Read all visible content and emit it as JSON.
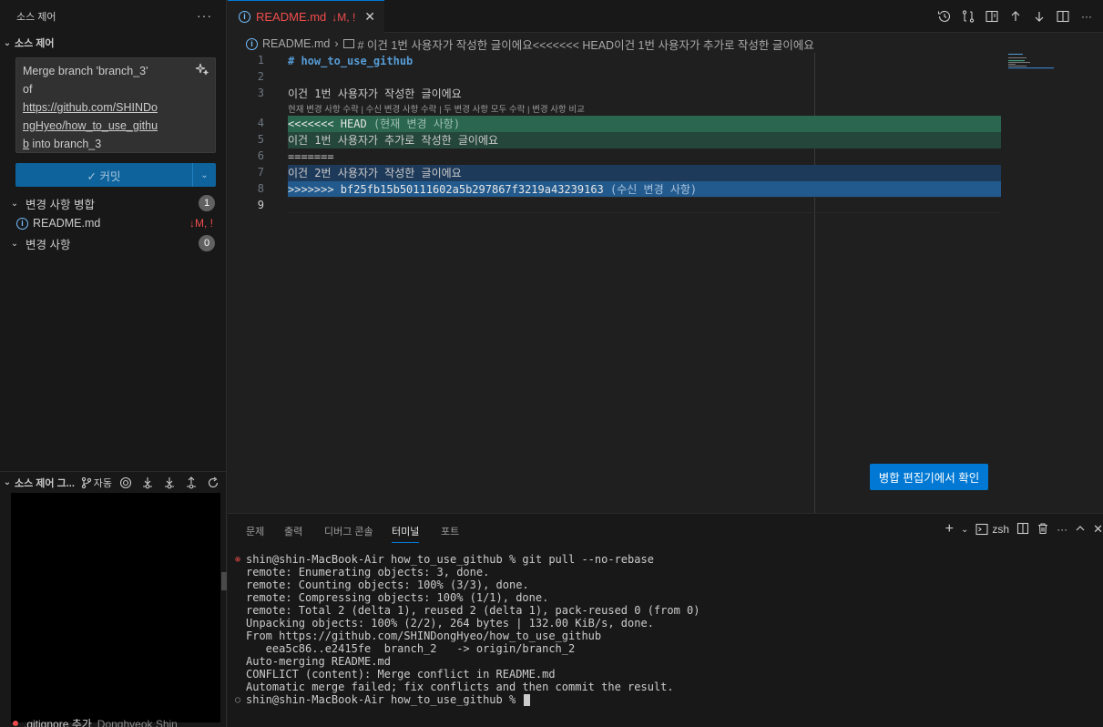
{
  "sidebar": {
    "header_title": "소스 제어",
    "more_label": "···",
    "section_title": "소스 제어",
    "commit_message_lines": [
      "Merge branch 'branch_3'",
      "of",
      "https://github.com/SHINDo",
      "ngHyeo/how_to_use_githu",
      "b into branch_3"
    ],
    "commit_button_label": "커밋",
    "merge_changes": {
      "label": "변경 사항 병합",
      "count": "1"
    },
    "file": {
      "name": "README.md",
      "status": "↓M, !"
    },
    "changes": {
      "label": "변경 사항",
      "count": "0"
    },
    "graph": {
      "title": "소스 제어 그...",
      "auto_label": "자동"
    },
    "gitignore_row": {
      "text": ".gitignore 추가",
      "author": "Donghyeok Shin"
    }
  },
  "editor": {
    "tab": {
      "name": "README.md",
      "status": "↓M, !"
    },
    "breadcrumb": {
      "file": "README.md",
      "symbol": "# 이건 1번 사용자가 작성한 글이에요<<<<<<< HEAD이건 1번 사용자가 추가로 작성한 글이에요"
    },
    "line_numbers": [
      "1",
      "2",
      "3",
      "4",
      "5",
      "6",
      "7",
      "8",
      "9"
    ],
    "lines": {
      "l1": "# how_to_use_github",
      "l3": "이건 1번 사용자가 작성한 글이에요",
      "codelens": "현재 변경 사항 수락 | 수신 변경 사항 수락 | 두 변경 사항 모두 수락 | 변경 사항 비교",
      "l4_marker": "<<<<<<< HEAD",
      "l4_hint": "(현재 변경 사항)",
      "l5": "이건 1번 사용자가 추가로 작성한 글이에요",
      "l6": "=======",
      "l7": "이건 2번 사용자가 작성한 글이에요",
      "l8_marker": ">>>>>>> bf25fb15b50111602a5b297867f3219a43239163",
      "l8_hint": "(수신 변경 사항)"
    },
    "merge_editor_button": "병합 편집기에서 확인"
  },
  "panel": {
    "tabs": [
      "문제",
      "출력",
      "디버그 콘솔",
      "터미널",
      "포트"
    ],
    "active_tab": "터미널",
    "shell_label": "zsh",
    "terminal_lines": [
      "shin@shin-MacBook-Air how_to_use_github % git pull --no-rebase",
      "remote: Enumerating objects: 3, done.",
      "remote: Counting objects: 100% (3/3), done.",
      "remote: Compressing objects: 100% (1/1), done.",
      "remote: Total 2 (delta 1), reused 2 (delta 1), pack-reused 0 (from 0)",
      "Unpacking objects: 100% (2/2), 264 bytes | 132.00 KiB/s, done.",
      "From https://github.com/SHINDongHyeo/how_to_use_github",
      "   eea5c86..e2415fe  branch_2   -> origin/branch_2",
      "Auto-merging README.md",
      "CONFLICT (content): Merge conflict in README.md",
      "Automatic merge failed; fix conflicts and then commit the result.",
      "shin@shin-MacBook-Air how_to_use_github % "
    ]
  },
  "colors": {
    "accent": "#0078d4",
    "error": "#f14c4c",
    "current_change": "#2a6650",
    "incoming_change": "#225a8d"
  }
}
